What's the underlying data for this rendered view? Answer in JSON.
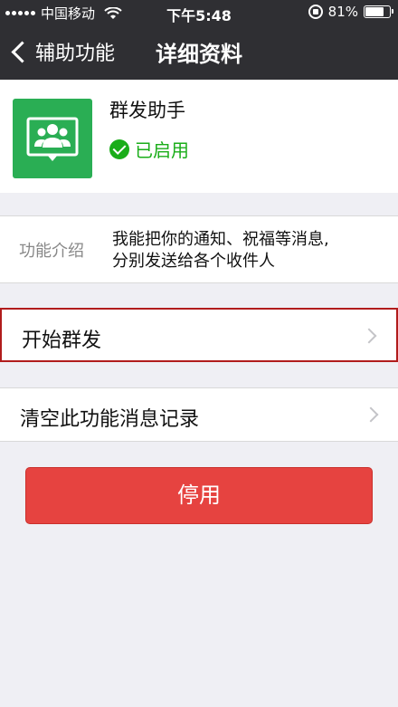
{
  "status_bar": {
    "carrier": "中国移动",
    "time": "下午5:48",
    "battery_percent": "81%",
    "battery_level": 0.81
  },
  "nav": {
    "back_label": "辅助功能",
    "title": "详细资料"
  },
  "profile": {
    "name": "群发助手",
    "status": "已启用",
    "icon": "group-chat-icon",
    "icon_color": "#2aae54"
  },
  "intro": {
    "key": "功能介绍",
    "value_line1": "我能把你的通知、祝福等消息,",
    "value_line2": "分别发送给各个收件人"
  },
  "cells": {
    "start_broadcast": "开始群发",
    "clear_records": "清空此功能消息记录"
  },
  "actions": {
    "disable_label": "停用",
    "disable_color": "#e64340"
  }
}
